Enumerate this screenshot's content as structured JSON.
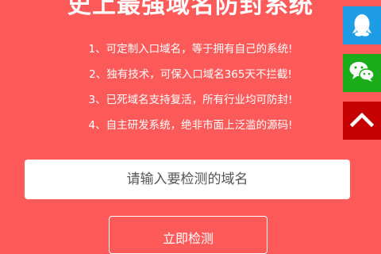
{
  "hero": {
    "title": "史上最强域名防封系统"
  },
  "features": [
    "1、可定制入口域名，等于拥有自己的系统!",
    "2、独有技术，可保入口域名365天不拦截!",
    "3、已死域名支持复活，所有行业均可防封!",
    "4、自主研发系统，绝非市面上泛滥的源码!"
  ],
  "search": {
    "placeholder": "请输入要检测的域名",
    "value": ""
  },
  "actions": {
    "check_label": "立即检测"
  },
  "sidebar": {
    "items": [
      {
        "icon": "qq-icon",
        "color": "#1e9de6"
      },
      {
        "icon": "wechat-icon",
        "color": "#1aad19"
      },
      {
        "icon": "chevron-up-icon",
        "color": "#c40000"
      }
    ]
  },
  "colors": {
    "background": "#ff5a5a",
    "text": "#ffffff"
  }
}
